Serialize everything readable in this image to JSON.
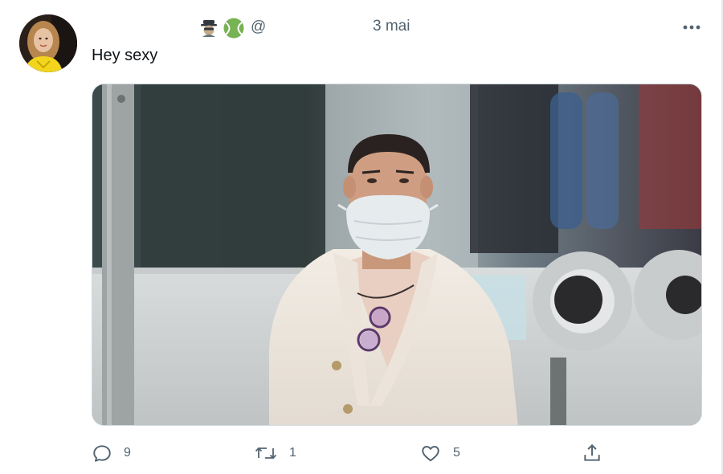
{
  "tweet": {
    "date": "3 mai",
    "handle": "@",
    "text": "Hey sexy",
    "author_emojis": [
      "detective-emoji",
      "tennis-ball-emoji"
    ]
  },
  "actions": {
    "reply_count": "9",
    "retweet_count": "1",
    "like_count": "5"
  },
  "colors": {
    "muted_text": "#536471",
    "primary_text": "#0f1419",
    "border": "#cfd9de"
  },
  "icons": {
    "reply": "reply-icon",
    "retweet": "retweet-icon",
    "like": "heart-icon",
    "share": "share-icon",
    "more": "more-icon"
  }
}
